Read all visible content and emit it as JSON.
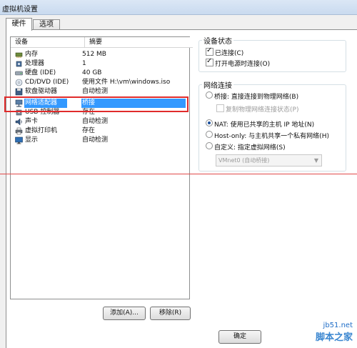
{
  "window": {
    "title": "虚拟机设置"
  },
  "tabs": [
    {
      "label": "硬件"
    },
    {
      "label": "选项"
    }
  ],
  "device_list": {
    "headers": {
      "device": "设备",
      "summary": "摘要"
    },
    "rows": [
      {
        "icon": "memory-icon",
        "device": "内存",
        "summary": "512 MB"
      },
      {
        "icon": "cpu-icon",
        "device": "处理器",
        "summary": "1"
      },
      {
        "icon": "hard-disk-icon",
        "device": "硬盘 (IDE)",
        "summary": "40 GB"
      },
      {
        "icon": "cd-dvd-icon",
        "device": "CD/DVD (IDE)",
        "summary": "使用文件 H:\\vm\\windows.iso"
      },
      {
        "icon": "floppy-icon",
        "device": "软盘驱动器",
        "summary": "自动检测"
      },
      {
        "icon": "network-adapter-icon",
        "device": "网络适配器",
        "summary": "桥接"
      },
      {
        "icon": "usb-icon",
        "device": "USB 控制器",
        "summary": "存在"
      },
      {
        "icon": "sound-icon",
        "device": "声卡",
        "summary": "自动检测"
      },
      {
        "icon": "printer-icon",
        "device": "虚拟打印机",
        "summary": "存在"
      },
      {
        "icon": "display-icon",
        "device": "显示",
        "summary": "自动检测"
      }
    ],
    "selected_device": "网络适配器"
  },
  "buttons": {
    "add": "添加(A)...",
    "remove": "移除(R)",
    "ok": "确定"
  },
  "device_status": {
    "title": "设备状态",
    "connected": {
      "label": "已连接(C)",
      "checked": true
    },
    "connect_at_power_on": {
      "label": "打开电源时连接(O)",
      "checked": true
    }
  },
  "network_connection": {
    "title": "网络连接",
    "options": [
      {
        "label": "桥接: 直接连接到物理网络(B)",
        "selected": false
      },
      {
        "label": "NAT: 使用已共享的主机 IP 地址(N)",
        "selected": true
      },
      {
        "label": "Host-only: 与主机共享一个私有网络(H)",
        "selected": false
      },
      {
        "label": "自定义: 指定虚拟网络(S)",
        "selected": false
      }
    ],
    "replicate": {
      "label": "复制物理网络连接状态(P)",
      "checked": false
    },
    "custom_network": "VMnet0 (自动桥接)"
  },
  "watermark": {
    "line1": "jb51.net",
    "line2": "脚本之家"
  }
}
